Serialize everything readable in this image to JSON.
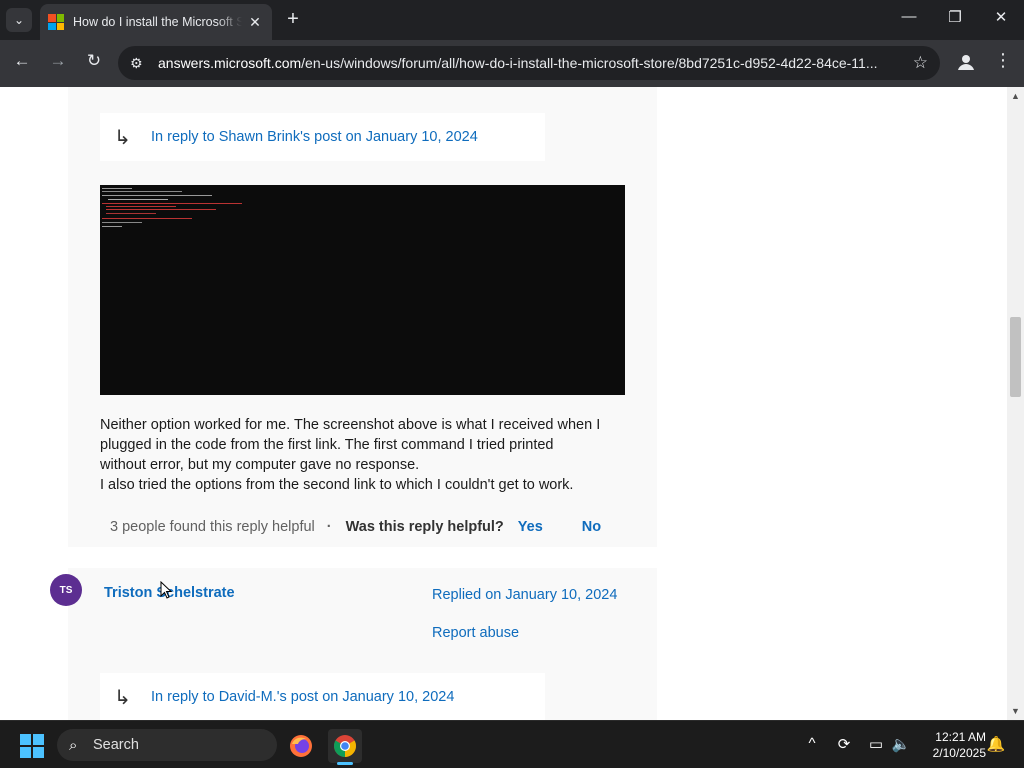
{
  "browser": {
    "tab_title": "How do I install the Microsoft Store?",
    "tab_close": "✕",
    "new_tab": "+",
    "url_domain": "answers.microsoft.com",
    "url_path": "/en-us/windows/forum/all/how-do-i-install-the-microsoft-store/8bd7251c-d952-4d22-84ce-11...",
    "window_controls": {
      "minimize": "—",
      "restore": "❐",
      "close": "✕"
    }
  },
  "post1": {
    "reply_to": "In reply to Shawn Brink's post on January 10, 2024",
    "body_lines": [
      "Neither option worked for me. The screenshot above is what I received when I",
      "plugged in the code from the first link. The first command I tried printed",
      "without error, but my computer gave no response.",
      "I also tried the options from the second link to which I couldn't get to work."
    ],
    "helpful_count": "3 people found this reply helpful",
    "separator": "·",
    "helpful_question": "Was this reply helpful?",
    "yes": "Yes",
    "no": "No"
  },
  "post2": {
    "avatar_initials": "TS",
    "author": "Triston Schelstrate",
    "replied": "Replied on January 10, 2024",
    "report": "Report abuse",
    "reply_to": "In reply to David-M.'s post on January 10, 2024"
  },
  "taskbar": {
    "search_label": "Search",
    "time": "12:21 AM",
    "date": "2/10/2025"
  },
  "colors": {
    "link": "#0f6cbd",
    "avatar": "#5c2e91",
    "chrome_bg": "#202124"
  }
}
